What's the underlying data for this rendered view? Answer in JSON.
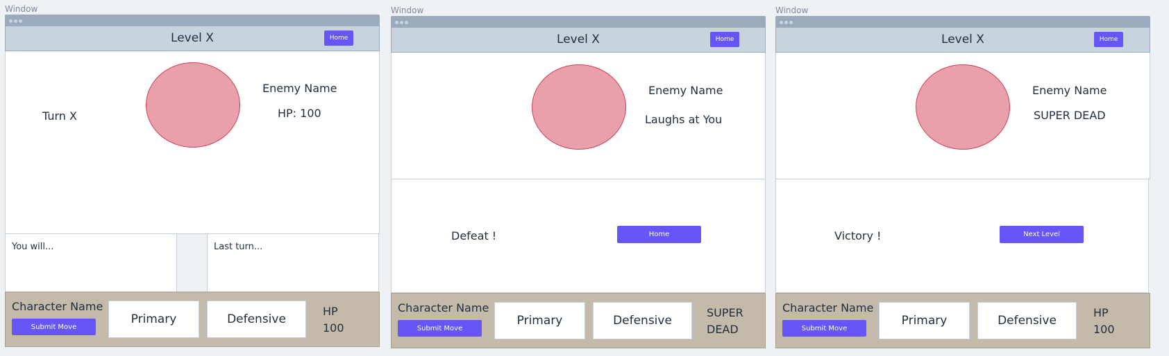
{
  "frames": [
    {
      "window_label": "Window",
      "title": "Level X",
      "home_label": "Home",
      "turn_text": "Turn X",
      "enemy_name": "Enemy Name",
      "enemy_status": "HP: 100",
      "you_will": "You will...",
      "last_turn": "Last turn...",
      "character_name": "Character Name",
      "submit_label": "Submit Move",
      "primary_label": "Primary",
      "defensive_label": "Defensive",
      "hp_label": "HP",
      "hp_value": "100"
    },
    {
      "window_label": "Window",
      "title": "Level X",
      "home_label": "Home",
      "enemy_name": "Enemy Name",
      "enemy_status": "Laughs at You",
      "result_text": "Defeat !",
      "result_button": "Home",
      "character_name": "Character Name",
      "submit_label": "Submit Move",
      "primary_label": "Primary",
      "defensive_label": "Defensive",
      "hp_label": "SUPER",
      "hp_value": "DEAD"
    },
    {
      "window_label": "Window",
      "title": "Level X",
      "home_label": "Home",
      "enemy_name": "Enemy Name",
      "enemy_status": "SUPER DEAD",
      "result_text": "Victory !",
      "result_button": "Next Level",
      "character_name": "Character Name",
      "submit_label": "Submit Move",
      "primary_label": "Primary",
      "defensive_label": "Defensive",
      "hp_label": "HP",
      "hp_value": "100"
    }
  ]
}
